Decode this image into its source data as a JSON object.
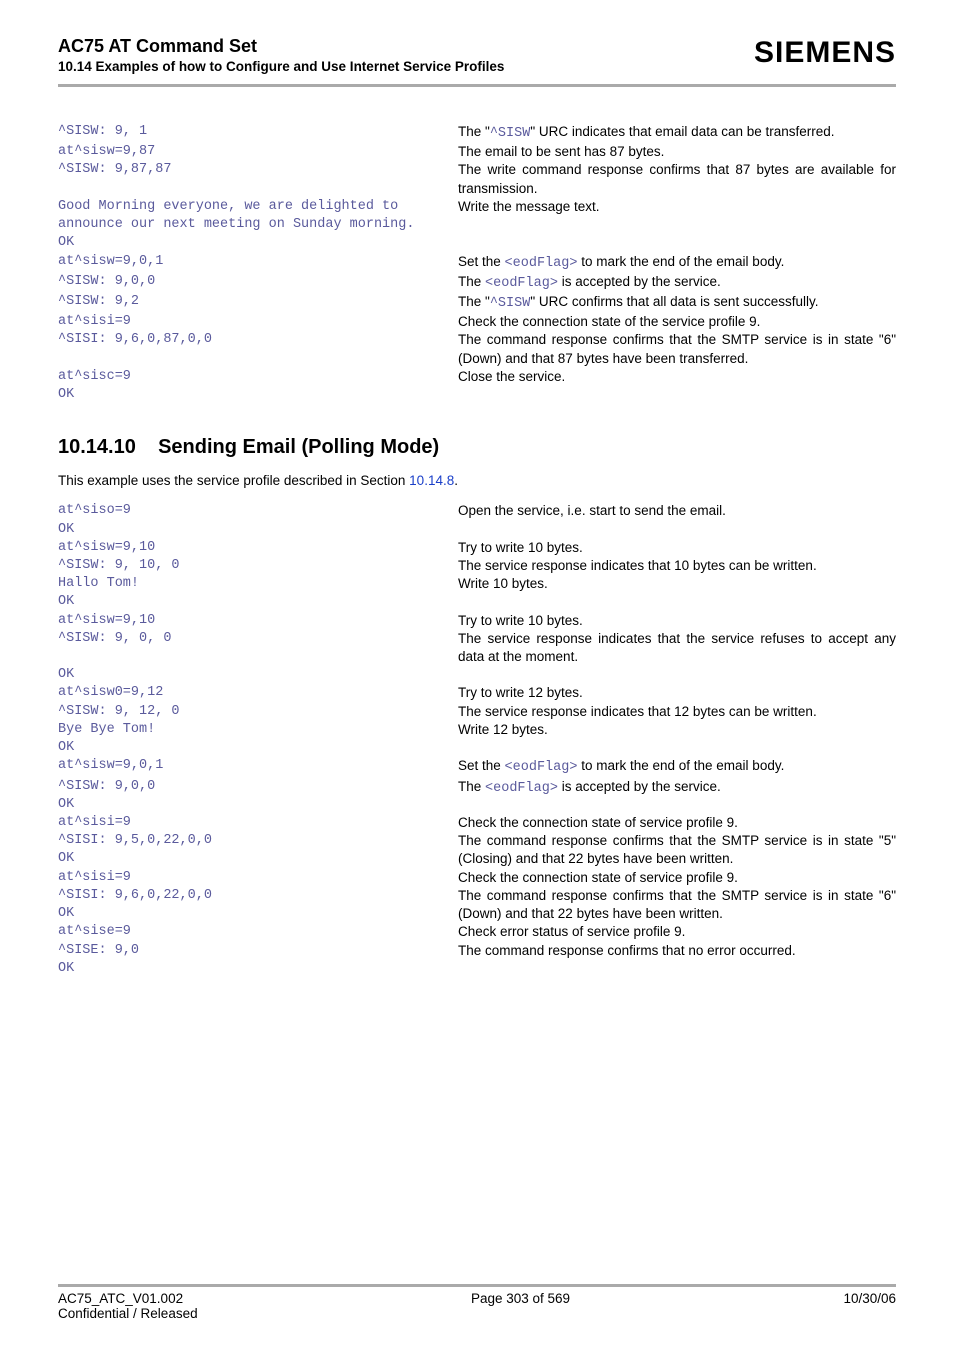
{
  "header": {
    "title": "AC75 AT Command Set",
    "section": "10.14 Examples of how to Configure and Use Internet Service Profiles",
    "brand": "SIEMENS"
  },
  "block1": [
    {
      "left": "^SISW: 9, 1",
      "right_pre": "The \"",
      "right_code1": "^SISW",
      "right_post": "\" URC indicates that email data can be transferred."
    },
    {
      "left": "at^sisw=9,87",
      "right_plain": "The email to be sent has 87 bytes."
    },
    {
      "left": "^SISW: 9,87,87",
      "right_plain": "The write command response confirms that 87 bytes are available for transmission."
    },
    {
      "left": "Good Morning everyone, we are delighted to announce our next meeting on Sunday morning.\nOK",
      "right_plain": "Write the message text."
    },
    {
      "left": "at^sisw=9,0,1",
      "right_pre": "Set the ",
      "right_code1": "<eodFlag>",
      "right_post": " to mark the end of the email body."
    },
    {
      "left": "^SISW: 9,0,0",
      "right_pre": "The ",
      "right_code1": "<eodFlag>",
      "right_post": " is accepted by the service."
    },
    {
      "left": "^SISW: 9,2",
      "right_pre": "The \"",
      "right_code1": "^SISW",
      "right_post": "\" URC confirms that all data is sent successfully."
    },
    {
      "left": "at^sisi=9",
      "right_plain": "Check the connection state of the service profile 9."
    },
    {
      "left": "^SISI: 9,6,0,87,0,0",
      "right_plain": "The command response confirms that the SMTP service is in state \"6\" (Down) and that 87 bytes have been transferred."
    },
    {
      "left": "at^sisc=9\nOK",
      "right_plain": "Close the service."
    }
  ],
  "subsection": {
    "number": "10.14.10",
    "title": "Sending Email (Polling Mode)",
    "intro_pre": "This example uses the service profile described in Section ",
    "intro_link": "10.14.8",
    "intro_post": "."
  },
  "block2": [
    {
      "left": "at^siso=9\nOK",
      "right_plain": "Open the service, i.e. start to send the email."
    },
    {
      "left": "at^sisw=9,10",
      "right_plain": "Try to write 10 bytes."
    },
    {
      "left": "^SISW: 9, 10, 0",
      "right_plain": "The service response indicates that 10 bytes can be written."
    },
    {
      "left": "Hallo Tom!\nOK",
      "right_plain": "Write 10 bytes."
    },
    {
      "left": "at^sisw=9,10",
      "right_plain": "Try to write 10 bytes."
    },
    {
      "left": "^SISW: 9, 0, 0",
      "right_plain": "The service response indicates that the service refuses to accept any data at the moment."
    },
    {
      "left": "OK",
      "right_plain": ""
    },
    {
      "left": "at^sisw0=9,12",
      "right_plain": "Try to write 12 bytes."
    },
    {
      "left": "^SISW: 9, 12, 0",
      "right_plain": "The service response indicates that 12 bytes can be written."
    },
    {
      "left": "Bye Bye Tom!\nOK",
      "right_plain": "Write 12 bytes."
    },
    {
      "left": "at^sisw=9,0,1",
      "right_pre": "Set the ",
      "right_code1": "<eodFlag>",
      "right_post": " to mark the end of the email body."
    },
    {
      "left": "^SISW: 9,0,0\nOK",
      "right_pre": "The ",
      "right_code1": "<eodFlag>",
      "right_post": " is accepted by the service."
    },
    {
      "left": "at^sisi=9",
      "right_plain": "Check the connection state of service profile 9."
    },
    {
      "left": "^SISI: 9,5,0,22,0,0\nOK",
      "right_plain": "The command response confirms that the SMTP service is in state \"5\" (Closing) and that 22 bytes have been written."
    },
    {
      "left": "at^sisi=9",
      "right_plain": "Check the connection state of service profile 9."
    },
    {
      "left": "^SISI: 9,6,0,22,0,0\nOK",
      "right_plain": "The command response confirms that the SMTP service is in state \"6\" (Down) and that 22 bytes have been written."
    },
    {
      "left": "at^sise=9",
      "right_plain": "Check error status of service profile 9."
    },
    {
      "left": "^SISE: 9,0",
      "right_plain": "The command response confirms that no error occurred."
    },
    {
      "left": "OK",
      "right_plain": ""
    }
  ],
  "footer": {
    "left1": "AC75_ATC_V01.002",
    "left2": "Confidential / Released",
    "mid": "Page 303 of 569",
    "right": "10/30/06"
  }
}
